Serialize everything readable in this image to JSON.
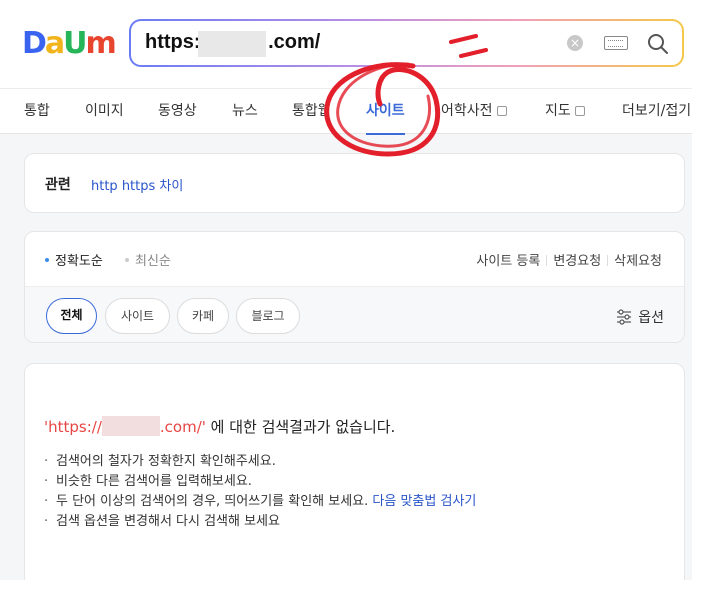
{
  "logo": {
    "letters": [
      "D",
      "a",
      "U",
      "m"
    ],
    "colors": [
      "#3a63f0",
      "#f2b41c",
      "#27b55a",
      "#e8452f"
    ]
  },
  "search": {
    "value_prefix": "https:/",
    "value_suffix": ".com/",
    "clear_icon": "×"
  },
  "tabs": [
    {
      "label": "통합"
    },
    {
      "label": "이미지"
    },
    {
      "label": "동영상"
    },
    {
      "label": "뉴스"
    },
    {
      "label": "통합웹"
    },
    {
      "label": "사이트"
    },
    {
      "label": "어학사전"
    },
    {
      "label": "지도"
    },
    {
      "label": "더보기/접기"
    }
  ],
  "related": {
    "title": "관련",
    "link": "http https 차이"
  },
  "sort": {
    "accuracy": "정확도순",
    "latest": "최신순",
    "links": [
      "사이트 등록",
      "변경요청",
      "삭제요청"
    ]
  },
  "filters": {
    "chips": [
      "전체",
      "사이트",
      "카페",
      "블로그"
    ],
    "option": "옵션"
  },
  "result": {
    "query_prefix": "'https://",
    "query_suffix": ".com/'",
    "message": " 에 대한 검색결과가 없습니다.",
    "tips": [
      "검색어의 철자가 정확한지 확인해주세요.",
      "비슷한 다른 검색어를 입력해보세요.",
      "두 단어 이상의 검색어의 경우, 띄어쓰기를 확인해 보세요."
    ],
    "tip3_link": "다음 맞춤법 검사기",
    "tip4": "검색 옵션을 변경해서 다시 검색해 보세요"
  },
  "colors": {
    "accent": "#3a6ad8",
    "annotation": "#e21f2a",
    "query": "#e84545"
  }
}
